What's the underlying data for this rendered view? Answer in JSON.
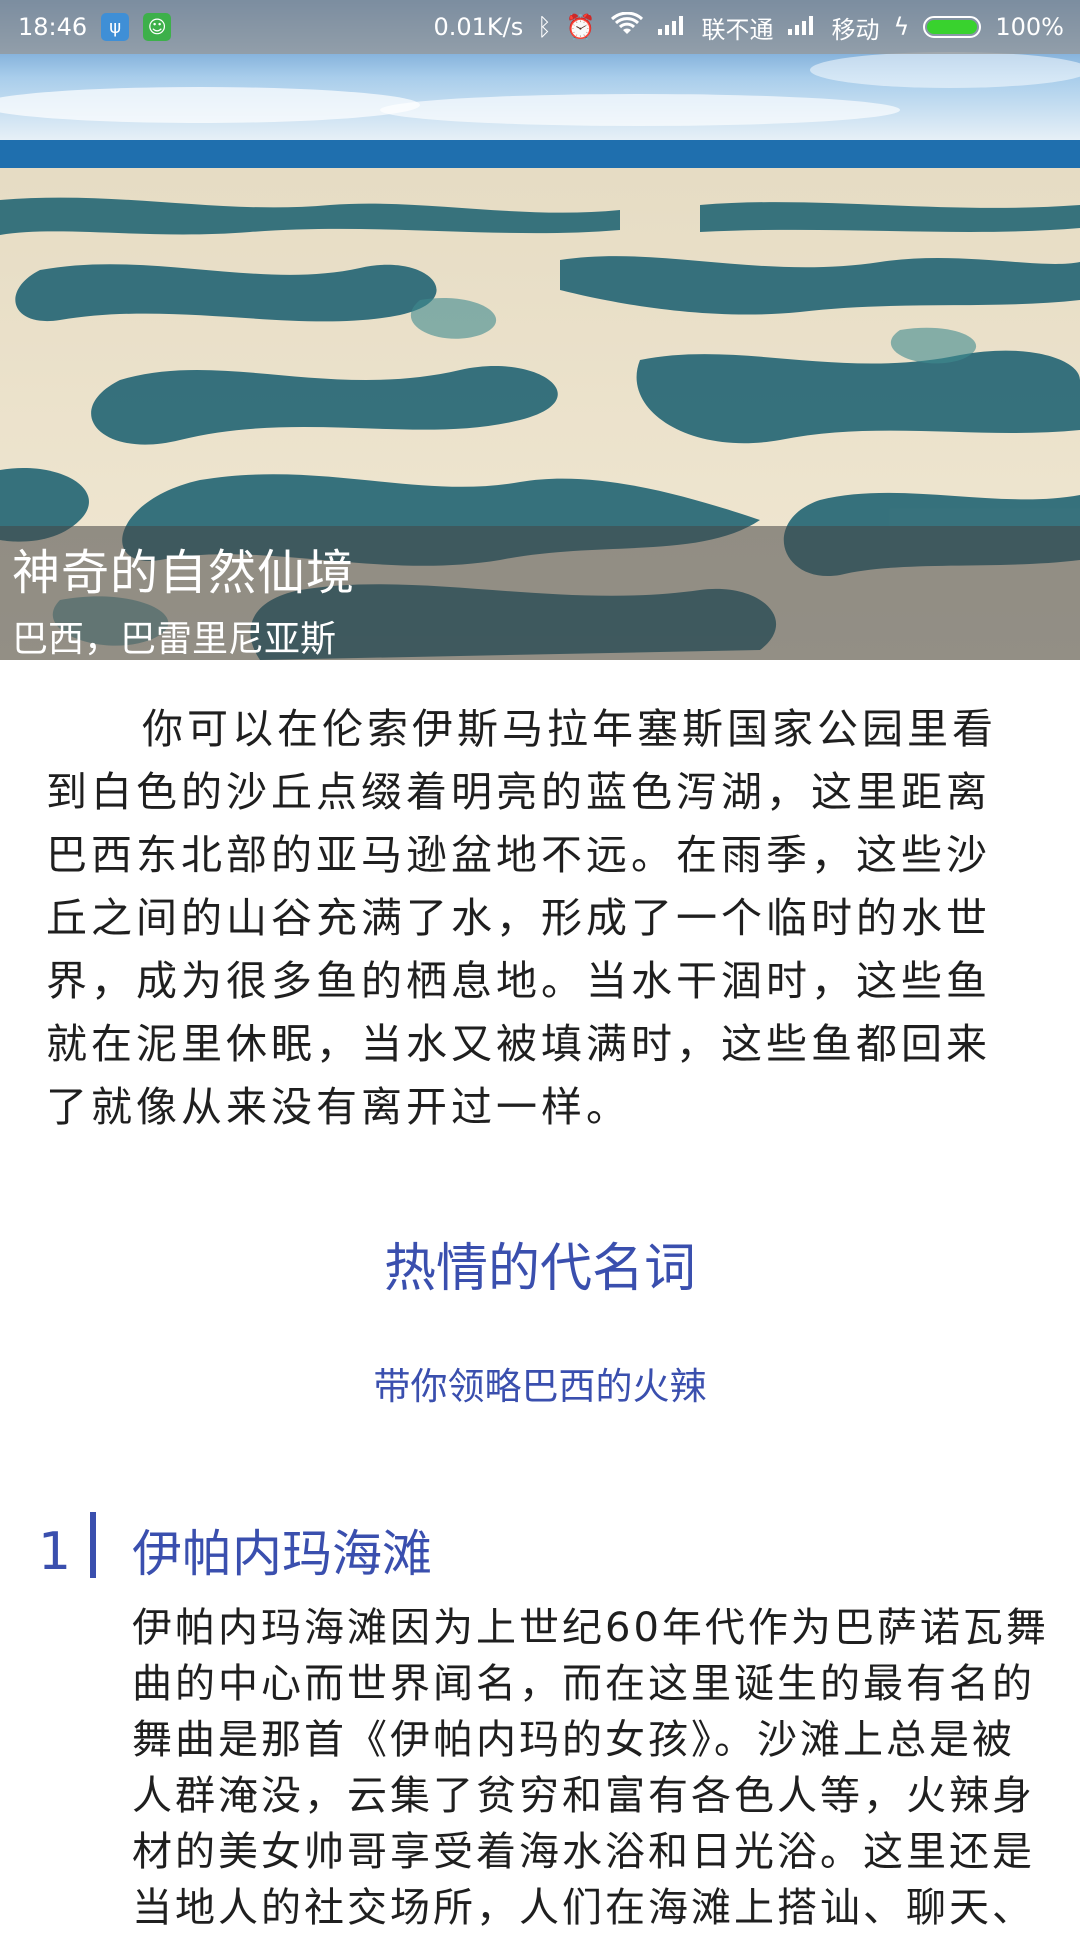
{
  "status_bar": {
    "time": "18:46",
    "net_speed": "0.01K/s",
    "carrier1": "联不通",
    "carrier2": "移动",
    "battery": "100%",
    "battery_level": 1.0,
    "icons": [
      "usb-icon",
      "android-icon",
      "bluetooth-icon",
      "alarm-icon",
      "wifi-icon",
      "signal-icon",
      "charging-icon",
      "battery-icon"
    ]
  },
  "hero": {
    "title": "神奇的自然仙境",
    "subtitle": "巴西，巴雷里尼亚斯"
  },
  "intro": "你可以在伦索伊斯马拉年塞斯国家公园里看到白色的沙丘点缀着明亮的蓝色泻湖，这里距离巴西东北部的亚马逊盆地不远。在雨季，这些沙丘之间的山谷充满了水，形成了一个临时的水世界，成为很多鱼的栖息地。当水干涸时，这些鱼就在泥里休眠，当水又被填满时，这些鱼都回来了就像从来没有离开过一样。",
  "section": {
    "title": "热情的代名词",
    "subtitle": "带你领略巴西的火辣"
  },
  "items": [
    {
      "number": "1",
      "title": "伊帕内玛海滩",
      "body": "伊帕内玛海滩因为上世纪60年代作为巴萨诺瓦舞曲的中心而世界闻名，而在这里诞生的最有名的舞曲是那首《伊帕内玛的女孩》。沙滩上总是被人群淹没，云集了贫穷和富有各色人等，火辣身材的美女帅哥享受着海水浴和日光浴。这里还是当地人的社交场所，人们在海滩上搭讪、聊天、"
    }
  ],
  "colors": {
    "accent": "#3a4fae",
    "text": "#1f1f1f"
  }
}
